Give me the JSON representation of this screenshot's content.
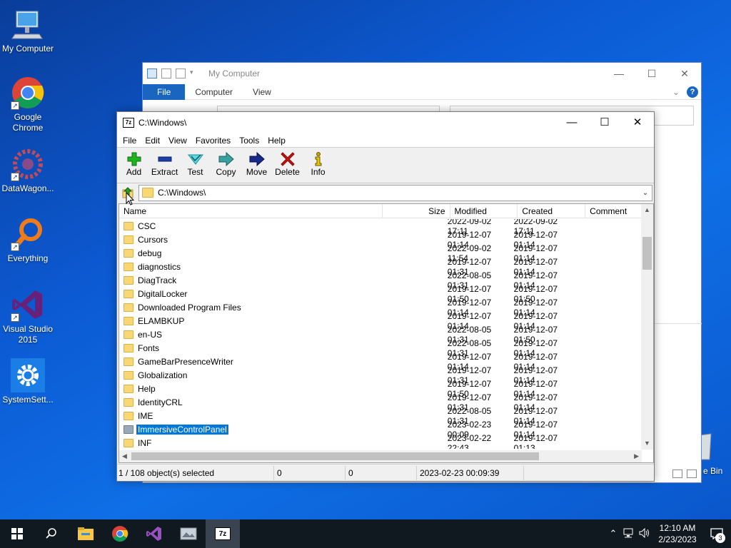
{
  "desktop": {
    "icons": [
      {
        "label": "My Computer"
      },
      {
        "label": "Google Chrome"
      },
      {
        "label": "DataWagon..."
      },
      {
        "label": "Everything"
      },
      {
        "label": "Visual Studio 2015"
      },
      {
        "label": "SystemSett..."
      }
    ],
    "recycle_label": "e Bin"
  },
  "explorer": {
    "title": "My Computer",
    "tabs": [
      "File",
      "Computer",
      "View"
    ],
    "help": "?"
  },
  "zip": {
    "title": "C:\\Windows\\",
    "menu": [
      "File",
      "Edit",
      "View",
      "Favorites",
      "Tools",
      "Help"
    ],
    "toolbar": [
      {
        "label": "Add",
        "icon": "plus-icon",
        "color": "#1fb31f"
      },
      {
        "label": "Extract",
        "icon": "minus-icon",
        "color": "#1c3fa8"
      },
      {
        "label": "Test",
        "icon": "check-icon",
        "color": "#2fb8c4"
      },
      {
        "label": "Copy",
        "icon": "copy-arrow-icon",
        "color": "#3a8f8f"
      },
      {
        "label": "Move",
        "icon": "move-arrow-icon",
        "color": "#1a2a8c"
      },
      {
        "label": "Delete",
        "icon": "x-icon",
        "color": "#d01010"
      },
      {
        "label": "Info",
        "icon": "info-icon",
        "color": "#c8a400"
      }
    ],
    "path": "C:\\Windows\\",
    "columns": {
      "name": "Name",
      "size": "Size",
      "modified": "Modified",
      "created": "Created",
      "comment": "Comment"
    },
    "rows": [
      {
        "name": "CSC",
        "modified": "2022-09-02 17:11",
        "created": "2022-09-02 17:11"
      },
      {
        "name": "Cursors",
        "modified": "2019-12-07 01:14",
        "created": "2019-12-07 01:14"
      },
      {
        "name": "debug",
        "modified": "2022-09-02 11:54",
        "created": "2019-12-07 01:14"
      },
      {
        "name": "diagnostics",
        "modified": "2019-12-07 01:31",
        "created": "2019-12-07 01:14"
      },
      {
        "name": "DiagTrack",
        "modified": "2022-08-05 01:31",
        "created": "2019-12-07 01:14"
      },
      {
        "name": "DigitalLocker",
        "modified": "2019-12-07 01:50",
        "created": "2019-12-07 01:50"
      },
      {
        "name": "Downloaded Program Files",
        "modified": "2019-12-07 01:14",
        "created": "2019-12-07 01:14"
      },
      {
        "name": "ELAMBKUP",
        "modified": "2019-12-07 01:14",
        "created": "2019-12-07 01:14"
      },
      {
        "name": "en-US",
        "modified": "2022-08-05 01:31",
        "created": "2019-12-07 01:50"
      },
      {
        "name": "Fonts",
        "modified": "2022-08-05 01:31",
        "created": "2019-12-07 01:14"
      },
      {
        "name": "GameBarPresenceWriter",
        "modified": "2019-12-07 01:14",
        "created": "2019-12-07 01:14"
      },
      {
        "name": "Globalization",
        "modified": "2019-12-07 01:31",
        "created": "2019-12-07 01:14"
      },
      {
        "name": "Help",
        "modified": "2019-12-07 01:50",
        "created": "2019-12-07 01:14"
      },
      {
        "name": "IdentityCRL",
        "modified": "2019-12-07 01:31",
        "created": "2019-12-07 01:14"
      },
      {
        "name": "IME",
        "modified": "2022-08-05 01:31",
        "created": "2019-12-07 01:14"
      },
      {
        "name": "ImmersiveControlPanel",
        "modified": "2023-02-23 00:09",
        "created": "2019-12-07 01:14",
        "selected": true
      },
      {
        "name": "INF",
        "modified": "2023-02-22 22:43",
        "created": "2019-12-07 01:13"
      }
    ],
    "status": {
      "selection": "1 / 108 object(s) selected",
      "size": "0",
      "packed": "0",
      "modified": "2023-02-23 00:09:39"
    }
  },
  "taskbar": {
    "apps": [
      "start-icon",
      "search-icon",
      "file-explorer-icon",
      "chrome-icon",
      "visual-studio-icon",
      "photo-app-icon",
      "7zip-icon"
    ],
    "active_app": "7zip-icon",
    "time": "12:10 AM",
    "date": "2/23/2023",
    "notifications": "3"
  }
}
